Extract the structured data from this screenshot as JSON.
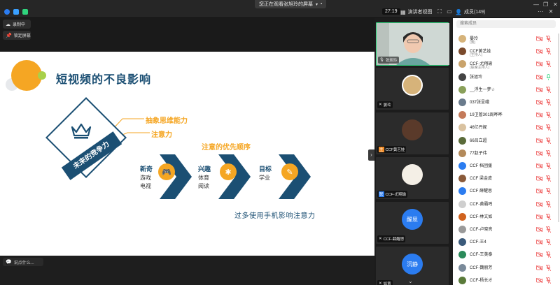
{
  "topbar": {
    "banner": "您正在观看张旭玲的屏幕",
    "timer": "27:19",
    "layout_label": "演讲者视图",
    "members_label": "成员(149)"
  },
  "left_tools": {
    "recording": "录制中",
    "lock_screen": "锁定屏幕",
    "chat_placeholder": "说点什么..."
  },
  "slide": {
    "title": "短视频的不良影响",
    "band_text": "未来的竞争力",
    "branch_1": "抽象思维能力",
    "branch_2": "注意力",
    "priority_title": "注意的优先顺序",
    "groups": [
      {
        "head": "新奇",
        "items": [
          "游戏",
          "电视"
        ]
      },
      {
        "head": "兴趣",
        "items": [
          "体育",
          "阅读"
        ]
      },
      {
        "head": "目标",
        "items": [
          "学业"
        ]
      }
    ],
    "bottom_text": "过多使用手机影响注意力",
    "colors": {
      "navy": "#1b4f73",
      "orange": "#f5a623",
      "green": "#a8d04a"
    }
  },
  "video_tiles": [
    {
      "name": "张旭玲",
      "type": "camera"
    },
    {
      "name": "晏玲",
      "type": "photo"
    },
    {
      "name": "CCF黄艺娃",
      "type": "photo"
    },
    {
      "name": "CCF-尤翔瑜",
      "type": "photo"
    },
    {
      "name": "CCF-薛醒思",
      "type": "text",
      "avatar_text": "醒思"
    },
    {
      "name": "如意",
      "type": "text",
      "avatar_text": "沉静"
    }
  ],
  "members": {
    "search_placeholder": "搜索成员",
    "list": [
      {
        "name": "晏玲",
        "role": "(我)",
        "color": "#d6b37a"
      },
      {
        "name": "CCF黄艺娃",
        "role": "(主持人)",
        "color": "#7a4a2c"
      },
      {
        "name": "CCF-尤翔瑜",
        "role": "(联席主持人)",
        "color": "#c9a36b"
      },
      {
        "name": "张旭玲",
        "role": "",
        "color": "#444444"
      },
      {
        "name": "__浮生一梦☆",
        "role": "",
        "color": "#8aa05a"
      },
      {
        "name": "037张呈峨",
        "role": "",
        "color": "#6a7b8c"
      },
      {
        "name": "19卫管301周晔晔",
        "role": "",
        "color": "#c47a5a"
      },
      {
        "name": "46亿丹妮",
        "role": "",
        "color": "#d9c2a0"
      },
      {
        "name": "66吕立超",
        "role": "",
        "color": "#5a6b3a"
      },
      {
        "name": "77赵子伟",
        "role": "",
        "color": "#b38a5a"
      },
      {
        "name": "CCF 档团援",
        "role": "",
        "color": "#2b7cf0"
      },
      {
        "name": "CCF 梁金皮",
        "role": "",
        "color": "#8a5a3a"
      },
      {
        "name": "CCF 薛醒思",
        "role": "",
        "color": "#2b7cf0"
      },
      {
        "name": "CCF-黄霸鸣",
        "role": "",
        "color": "#cfcfcf"
      },
      {
        "name": "CCF-林文如",
        "role": "",
        "color": "#d0621e"
      },
      {
        "name": "CCF-卢晓亮",
        "role": "",
        "color": "#9a9a9a"
      },
      {
        "name": "CCF-王4",
        "role": "",
        "color": "#3a5a7a"
      },
      {
        "name": "CCF-王美泰",
        "role": "",
        "color": "#2a8a5a"
      },
      {
        "name": "CCF-魏丽芳",
        "role": "",
        "color": "#7a8a9a"
      },
      {
        "name": "CCF-杨长才",
        "role": "",
        "color": "#5a7a3a"
      }
    ]
  }
}
